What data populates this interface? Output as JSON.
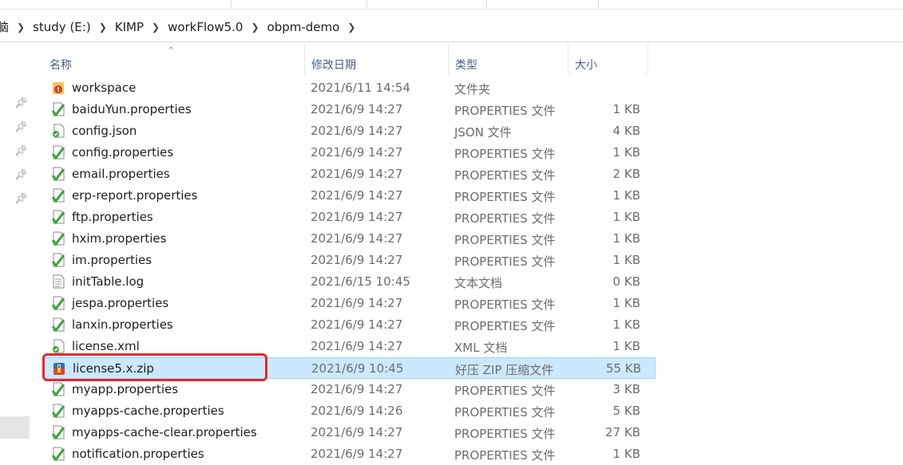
{
  "address": {
    "frag": "脑",
    "crumbs": [
      "study (E:)",
      "KIMP",
      "workFlow5.0",
      "obpm-demo"
    ]
  },
  "columns": {
    "name": "名称",
    "date": "修改日期",
    "type": "类型",
    "size": "大小"
  },
  "files": [
    {
      "name": "workspace",
      "date": "2021/6/11 14:54",
      "type": "文件夹",
      "size": "",
      "icon": "folder-icon"
    },
    {
      "name": "baiduYun.properties",
      "date": "2021/6/9 14:27",
      "type": "PROPERTIES 文件",
      "size": "1 KB",
      "icon": "properties-file-icon"
    },
    {
      "name": "config.json",
      "date": "2021/6/9 14:27",
      "type": "JSON 文件",
      "size": "4 KB",
      "icon": "json-file-icon"
    },
    {
      "name": "config.properties",
      "date": "2021/6/9 14:27",
      "type": "PROPERTIES 文件",
      "size": "1 KB",
      "icon": "properties-file-icon"
    },
    {
      "name": "email.properties",
      "date": "2021/6/9 14:27",
      "type": "PROPERTIES 文件",
      "size": "2 KB",
      "icon": "properties-file-icon"
    },
    {
      "name": "erp-report.properties",
      "date": "2021/6/9 14:27",
      "type": "PROPERTIES 文件",
      "size": "1 KB",
      "icon": "properties-file-icon"
    },
    {
      "name": "ftp.properties",
      "date": "2021/6/9 14:27",
      "type": "PROPERTIES 文件",
      "size": "1 KB",
      "icon": "properties-file-icon"
    },
    {
      "name": "hxim.properties",
      "date": "2021/6/9 14:27",
      "type": "PROPERTIES 文件",
      "size": "1 KB",
      "icon": "properties-file-icon"
    },
    {
      "name": "im.properties",
      "date": "2021/6/9 14:27",
      "type": "PROPERTIES 文件",
      "size": "1 KB",
      "icon": "properties-file-icon"
    },
    {
      "name": "initTable.log",
      "date": "2021/6/15 10:45",
      "type": "文本文档",
      "size": "0 KB",
      "icon": "text-file-icon"
    },
    {
      "name": "jespa.properties",
      "date": "2021/6/9 14:27",
      "type": "PROPERTIES 文件",
      "size": "1 KB",
      "icon": "properties-file-icon"
    },
    {
      "name": "lanxin.properties",
      "date": "2021/6/9 14:27",
      "type": "PROPERTIES 文件",
      "size": "1 KB",
      "icon": "properties-file-icon"
    },
    {
      "name": "license.xml",
      "date": "2021/6/9 14:27",
      "type": "XML 文档",
      "size": "1 KB",
      "icon": "xml-file-icon"
    },
    {
      "name": "license5.x.zip",
      "date": "2021/6/9 10:45",
      "type": "好压 ZIP 压缩文件",
      "size": "55 KB",
      "icon": "zip-archive-icon",
      "selected": true
    },
    {
      "name": "myapp.properties",
      "date": "2021/6/9 14:27",
      "type": "PROPERTIES 文件",
      "size": "3 KB",
      "icon": "properties-file-icon"
    },
    {
      "name": "myapps-cache.properties",
      "date": "2021/6/9 14:26",
      "type": "PROPERTIES 文件",
      "size": "5 KB",
      "icon": "properties-file-icon"
    },
    {
      "name": "myapps-cache-clear.properties",
      "date": "2021/6/9 14:27",
      "type": "PROPERTIES 文件",
      "size": "27 KB",
      "icon": "properties-file-icon"
    },
    {
      "name": "notification.properties",
      "date": "2021/6/9 14:27",
      "type": "PROPERTIES 文件",
      "size": "1 KB",
      "icon": "properties-file-icon"
    }
  ],
  "colors": {
    "selection_bg": "#cce8ff",
    "selection_border": "#99d1ff",
    "highlight_outline": "#e8262a",
    "header_text": "#4c607a"
  }
}
